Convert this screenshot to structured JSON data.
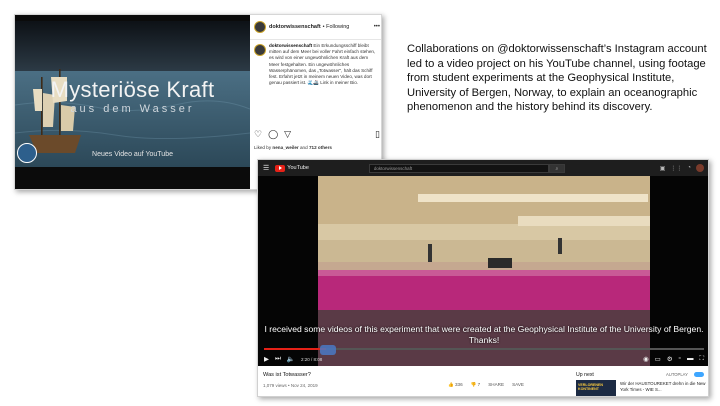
{
  "instagram": {
    "username": "doktorwissenschaft",
    "follow_label": "• Following",
    "more_label": "•••",
    "video_title": "Mysteriöse Kraft",
    "video_subtitle": "aus dem Wasser",
    "video_footer": "Neues Video auf YouTube",
    "caption": "Ein Erkundungsschiff bleibt mitten auf dem Meer bei voller Fahrt einfach stehen, es wird von einer ungewöhnlichen Kraft aus dem Meer festgehalten. Ein ungewöhnliches Wasserphänomen, das „Totwasser\", hält das Schiff fest. Erfahrt jetzt in meinem neuen Video, was dort genau passiert ist. 🌊🚢 Link in meiner Bio.",
    "liked_prefix": "Liked by",
    "liked_user": "nena_weiler",
    "liked_and": "and",
    "liked_others": "712 others"
  },
  "description": "Collaborations on @doktorwissenschaft’s Instagram account led to a video project on his YouTube channel, using footage from student experiments at the Geophysical Institute, University of Bergen, Norway, to explain an oceanographic phenomenon and the history behind its discovery.",
  "youtube": {
    "brand": "YouTube",
    "search_query": "doktorwissenschaft",
    "subtitle_line1": "I received some videos of this experiment that were created at the Geophysical Institute of the University of Bergen.",
    "subtitle_line2": "Thanks!",
    "time": "2:20 / 8:08",
    "progress": 0.14,
    "video_title": "Was ist Totwasser?",
    "video_meta": "1,079 views • Nov 24, 2019",
    "likes": "336",
    "dislikes": "7",
    "share_label": "SHARE",
    "save_label": "SAVE",
    "up_next_label": "Up next",
    "autoplay_label": "AUTOPLAY",
    "next_badge": "VERLORENEN KONTINENT",
    "next_title": "Wir der HAUSTOUREKET drehn in die New York Times - WIE S..."
  },
  "colors": {
    "yt_red": "#e62117",
    "water_pink": "#b8287a",
    "ig_sea": "#3f6379"
  }
}
